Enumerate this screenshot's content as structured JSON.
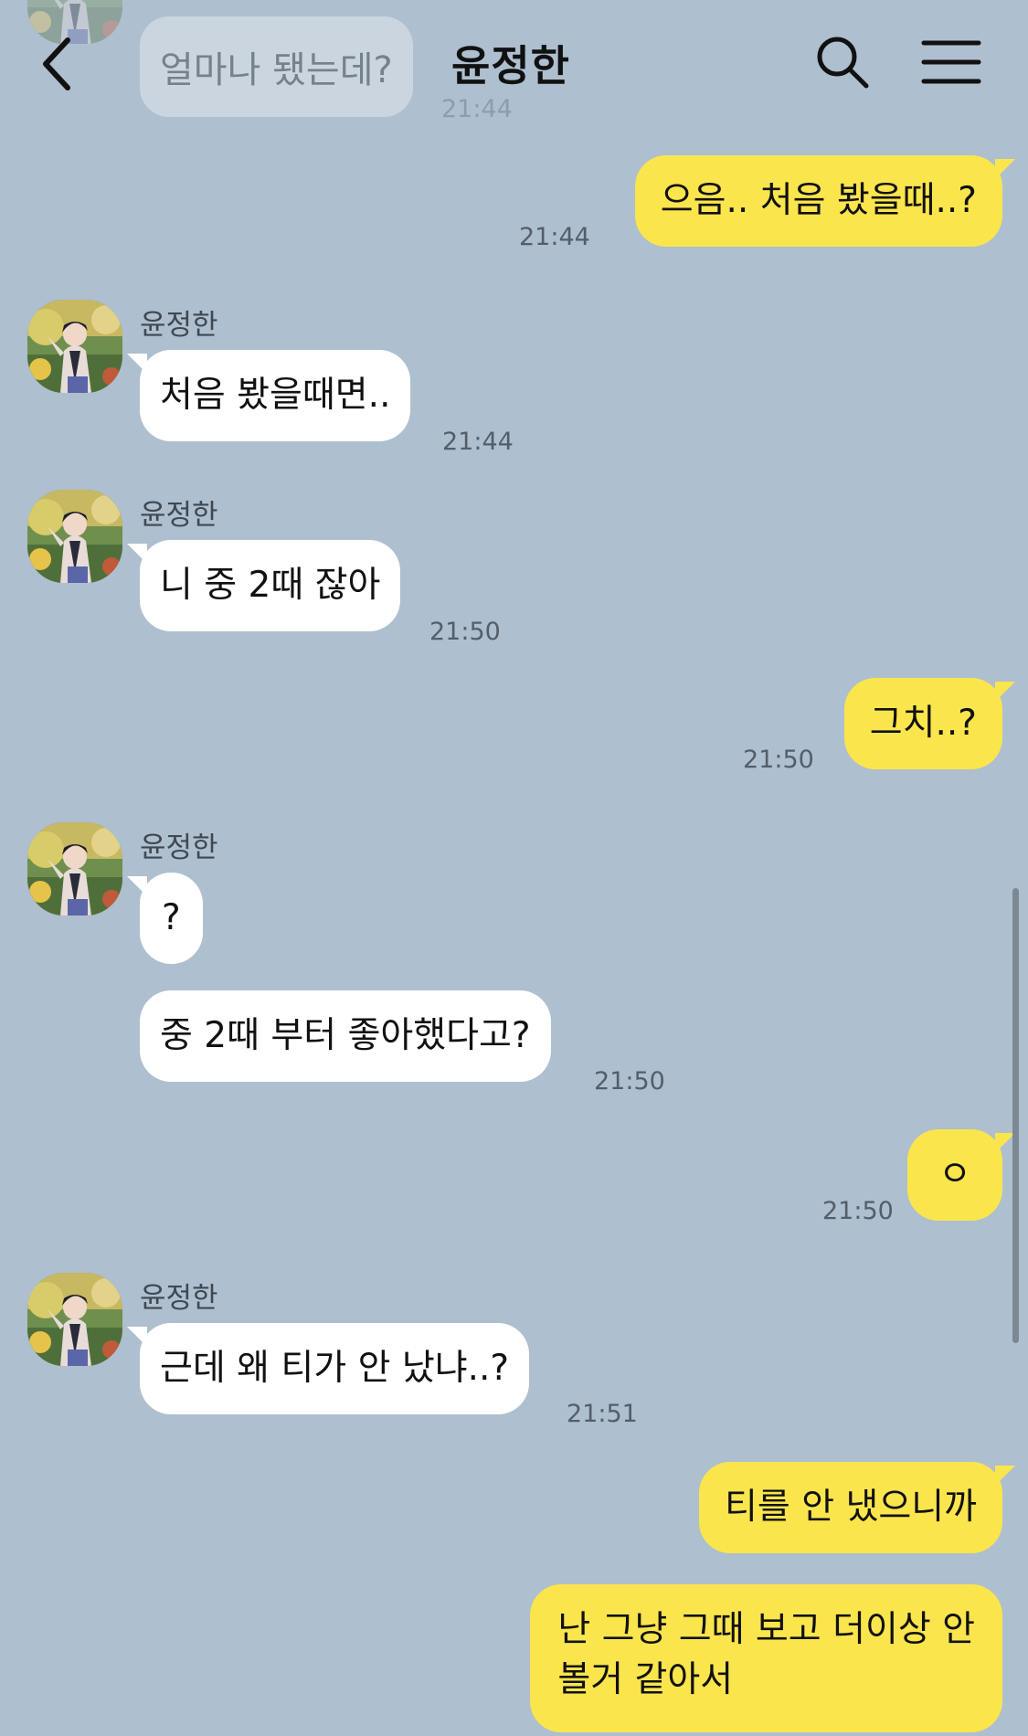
{
  "header": {
    "title": "윤정한",
    "back_icon": "chevron-left-icon",
    "search_icon": "search-icon",
    "menu_icon": "hamburger-menu-icon"
  },
  "colors": {
    "background": "#aebfcf",
    "incoming_bubble": "#ffffff",
    "outgoing_bubble": "#fbe54d"
  },
  "faded_message": {
    "text": "얼마나 됐는데?",
    "time": "21:44"
  },
  "messages": [
    {
      "direction": "out",
      "text": "으음.. 처음 봤을때..?",
      "time": "21:44"
    },
    {
      "direction": "in",
      "sender": "윤정한",
      "text": "처음 봤을때면..",
      "time": "21:44"
    },
    {
      "direction": "in",
      "sender": "윤정한",
      "text": "니 중 2때 잖아",
      "time": "21:50"
    },
    {
      "direction": "out",
      "text": "그치..?",
      "time": "21:50"
    },
    {
      "direction": "in",
      "sender": "윤정한",
      "text": "?",
      "time": ""
    },
    {
      "direction": "in",
      "text": "중 2때 부터 좋아했다고?",
      "time": "21:50"
    },
    {
      "direction": "out",
      "text": "ㅇ",
      "time": "21:50"
    },
    {
      "direction": "in",
      "sender": "윤정한",
      "text": "근데 왜 티가 안 났냐..?",
      "time": "21:51"
    },
    {
      "direction": "out",
      "text": "티를 안 냈으니까",
      "time": ""
    },
    {
      "direction": "out",
      "text_line1": "난 그냥 그때 보고 더이상 안",
      "text_line2": "볼거 같아서",
      "time": ""
    }
  ]
}
